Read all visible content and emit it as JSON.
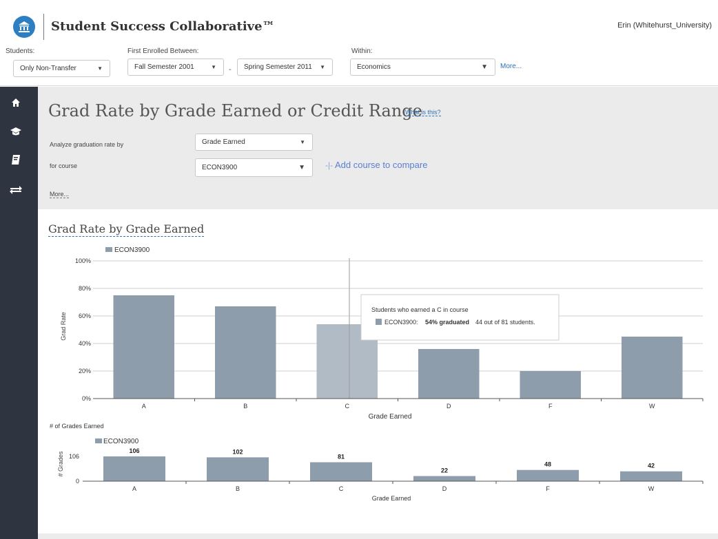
{
  "header": {
    "app_title": "Student Success Collaborative™",
    "user": "Erin (Whitehurst_University)"
  },
  "filters": {
    "students_label": "Students:",
    "students_value": "Only Non-Transfer",
    "enrolled_label": "First Enrolled Between:",
    "enrolled_from": "Fall Semester 2001",
    "dash": "-",
    "enrolled_to": "Spring Semester 2011",
    "within_label": "Within:",
    "within_value": "Economics",
    "more": "More..."
  },
  "sidebar": {
    "icons": [
      "home-icon",
      "graduation-cap-icon",
      "book-icon",
      "exchange-arrows-icon"
    ]
  },
  "config": {
    "page_title": "Grad Rate by Grade Earned or Credit Range",
    "what_is_this": "What is this?",
    "analyze_label": "Analyze graduation rate by",
    "analyze_value": "Grade Earned",
    "course_label": "for course",
    "course_value": "ECON3900",
    "add_course": "Add course to compare",
    "more": "More..."
  },
  "chart_title": "Grad Rate by Grade Earned",
  "tooltip": {
    "heading": "Students who earned a C in course",
    "series": "ECON3900:",
    "graduated": "54% graduated",
    "detail": "44 out of 81 students."
  },
  "colors": {
    "bar": "#8e9dab",
    "bar_highlight": "#b1bbc6",
    "accent": "#2b6fb5",
    "sidebar": "#2e3440"
  },
  "chart_data": [
    {
      "type": "bar",
      "categories": [
        "A",
        "B",
        "C",
        "D",
        "F",
        "W"
      ],
      "series": [
        {
          "name": "ECON3900",
          "values": [
            75,
            67,
            54,
            36,
            20,
            45
          ]
        }
      ],
      "xlabel": "Grade Earned",
      "ylabel": "Grad Rate",
      "ylim": [
        0,
        100
      ],
      "yticks": [
        "0%",
        "20%",
        "40%",
        "60%",
        "80%",
        "100%"
      ],
      "grid": true,
      "legend": "top-left",
      "highlighted": "C"
    },
    {
      "type": "bar",
      "title": "# of Grades Earned",
      "categories": [
        "A",
        "B",
        "C",
        "D",
        "F",
        "W"
      ],
      "series": [
        {
          "name": "ECON3900",
          "values": [
            106,
            102,
            81,
            22,
            48,
            42
          ]
        }
      ],
      "xlabel": "Grade Earned",
      "ylabel": "# Grades",
      "ylim": [
        0,
        106
      ],
      "yticks": [
        "0",
        "106"
      ],
      "legend": "top-left"
    }
  ]
}
